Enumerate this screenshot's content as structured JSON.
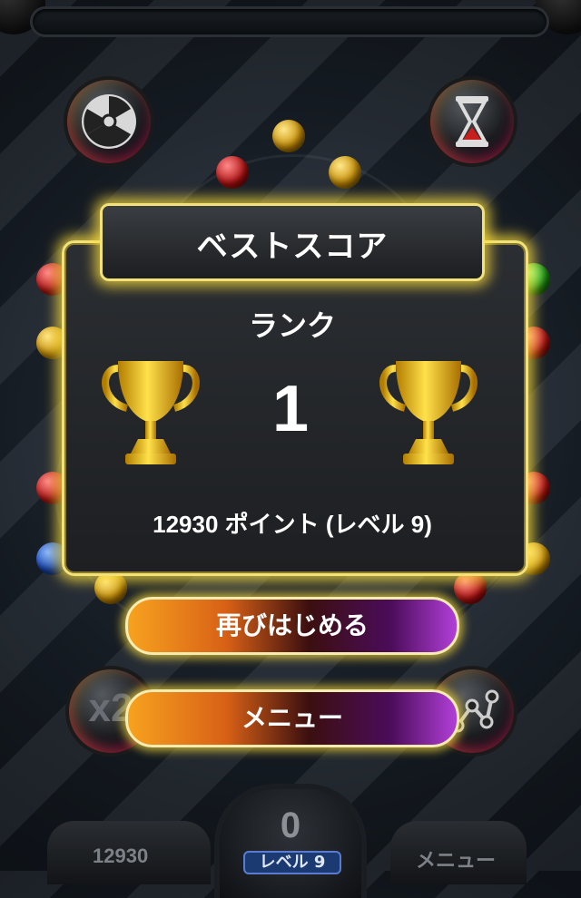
{
  "dialog": {
    "title": "ベストスコア",
    "rank_label": "ランク",
    "rank_value": "1",
    "score_line": "12930  ポイント  (レベル  9)"
  },
  "buttons": {
    "restart": "再びはじめる",
    "menu": "メニュー"
  },
  "hud": {
    "score": "12930",
    "center_value": "0",
    "level": "レベル 9",
    "menu": "メニュー"
  },
  "powerups": {
    "top_left": "radiation-icon",
    "top_right": "hourglass-icon",
    "bottom_left_label": "x2",
    "bottom_right": "connect-nodes-icon"
  },
  "colors": {
    "glow": "#f3e27a",
    "button_orange": "#f7a21f",
    "button_purple": "#b23fd8",
    "trophy_gold": "#f2c21a"
  }
}
